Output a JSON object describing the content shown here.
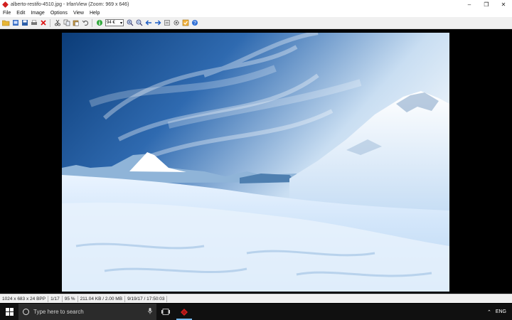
{
  "window": {
    "title": "alberto-restifo-4510.jpg - IrfanView (Zoom: 969 x 646)",
    "controls": [
      "–",
      "❐",
      "✕"
    ]
  },
  "menu": [
    "File",
    "Edit",
    "Image",
    "Options",
    "View",
    "Help"
  ],
  "toolbar": {
    "zoom_value": "94 €"
  },
  "status": {
    "dimensions": "1024 x 683 x 24 BPP",
    "index": "1/17",
    "zoom": "95 %",
    "filesize": "211.04 KB / 2.00 MB",
    "datetime": "9/19/17 / 17:50:03"
  },
  "taskbar": {
    "search_placeholder": "Type here to search",
    "language": "ENG"
  },
  "colors": {
    "accent": "#76b9ed",
    "brand": "#d21f1f"
  }
}
